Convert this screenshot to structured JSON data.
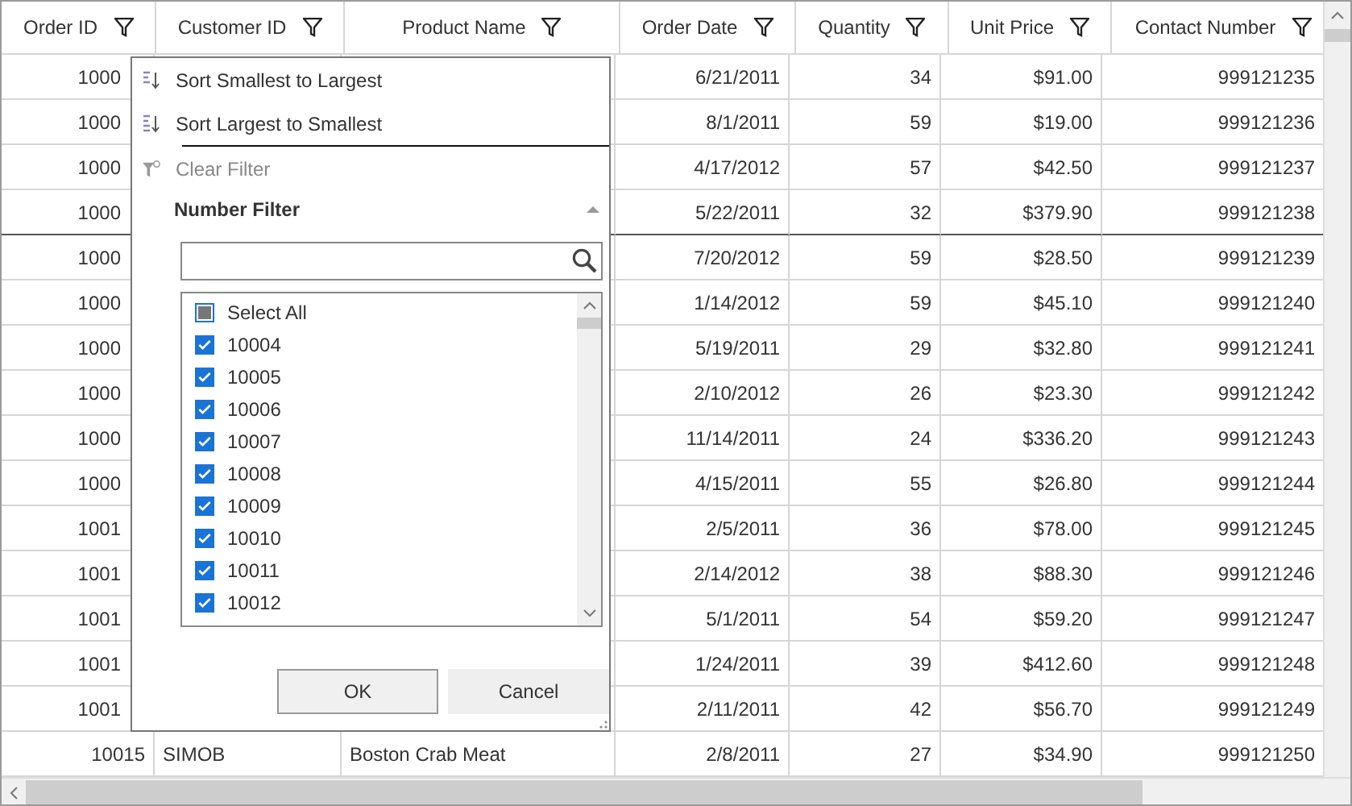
{
  "grid": {
    "columns": [
      {
        "label": "Order ID"
      },
      {
        "label": "Customer ID"
      },
      {
        "label": "Product Name"
      },
      {
        "label": "Order Date"
      },
      {
        "label": "Quantity"
      },
      {
        "label": "Unit Price"
      },
      {
        "label": "Contact Number"
      }
    ],
    "rows": [
      {
        "cells": [
          "1000",
          null,
          null,
          "6/21/2011",
          "34",
          "$91.00",
          "999121235"
        ]
      },
      {
        "cells": [
          "1000",
          null,
          null,
          "8/1/2011",
          "59",
          "$19.00",
          "999121236"
        ]
      },
      {
        "cells": [
          "1000",
          null,
          null,
          "4/17/2012",
          "57",
          "$42.50",
          "999121237"
        ]
      },
      {
        "cells": [
          "1000",
          null,
          null,
          "5/22/2011",
          "32",
          "$379.90",
          "999121238"
        ],
        "frozen_divider": true
      },
      {
        "cells": [
          "1000",
          null,
          null,
          "7/20/2012",
          "59",
          "$28.50",
          "999121239"
        ]
      },
      {
        "cells": [
          "1000",
          null,
          null,
          "1/14/2012",
          "59",
          "$45.10",
          "999121240"
        ]
      },
      {
        "cells": [
          "1000",
          null,
          null,
          "5/19/2011",
          "29",
          "$32.80",
          "999121241"
        ]
      },
      {
        "cells": [
          "1000",
          null,
          null,
          "2/10/2012",
          "26",
          "$23.30",
          "999121242"
        ]
      },
      {
        "cells": [
          "1000",
          null,
          null,
          "11/14/2011",
          "24",
          "$336.20",
          "999121243"
        ]
      },
      {
        "cells": [
          "1000",
          null,
          null,
          "4/15/2011",
          "55",
          "$26.80",
          "999121244"
        ]
      },
      {
        "cells": [
          "1001",
          null,
          null,
          "2/5/2011",
          "36",
          "$78.00",
          "999121245"
        ]
      },
      {
        "cells": [
          "1001",
          null,
          null,
          "2/14/2012",
          "38",
          "$88.30",
          "999121246"
        ]
      },
      {
        "cells": [
          "1001",
          null,
          null,
          "5/1/2011",
          "54",
          "$59.20",
          "999121247"
        ]
      },
      {
        "cells": [
          "1001",
          null,
          null,
          "1/24/2011",
          "39",
          "$412.60",
          "999121248"
        ]
      },
      {
        "cells": [
          "1001",
          null,
          null,
          "2/11/2011",
          "42",
          "$56.70",
          "999121249"
        ]
      },
      {
        "cells": [
          "10015",
          "SIMOB",
          "Boston Crab Meat",
          "2/8/2011",
          "27",
          "$34.90",
          "999121250"
        ]
      }
    ]
  },
  "filter_popup": {
    "sort_items": [
      {
        "label": "Sort Smallest to Largest",
        "kind": "ascending"
      },
      {
        "label": "Sort Largest to Smallest",
        "kind": "descending"
      }
    ],
    "clear_filter": {
      "label": "Clear Filter",
      "disabled": true
    },
    "section": {
      "label": "Number Filter",
      "expanded": true
    },
    "select_all": {
      "label": "Select All",
      "checked": false,
      "indeterminate": true
    },
    "values": [
      {
        "label": "10004",
        "checked": true
      },
      {
        "label": "10005",
        "checked": true
      },
      {
        "label": "10006",
        "checked": true
      },
      {
        "label": "10007",
        "checked": true
      },
      {
        "label": "10008",
        "checked": true
      },
      {
        "label": "10009",
        "checked": true
      },
      {
        "label": "10010",
        "checked": true
      },
      {
        "label": "10011",
        "checked": true
      },
      {
        "label": "10012",
        "checked": true
      }
    ],
    "buttons": [
      {
        "label": "OK",
        "kind": "primary"
      },
      {
        "label": "Cancel",
        "kind": "secondary"
      }
    ]
  }
}
